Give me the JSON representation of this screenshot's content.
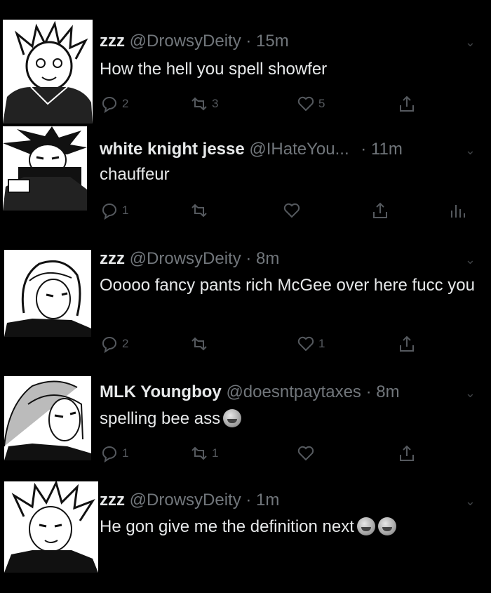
{
  "tweets": [
    {
      "name": "zzz",
      "handle": "@DrowsyDeity",
      "time": "· 15m",
      "text": "How the hell you spell showfer",
      "replies": "2",
      "retweets": "3",
      "likes": "5",
      "show_analytics": false
    },
    {
      "name": "white knight jesse",
      "handle": "@IHateYou...",
      "time": "· 11m",
      "text": "chauffeur",
      "replies": "1",
      "retweets": "",
      "likes": "",
      "show_analytics": true
    },
    {
      "name": "zzz",
      "handle": "@DrowsyDeity",
      "time": "· 8m",
      "text": "Ooooo fancy pants rich McGee over here fucc you",
      "replies": "2",
      "retweets": "",
      "likes": "1",
      "show_analytics": false
    },
    {
      "name": "MLK Youngboy",
      "handle": "@doesntpaytaxes",
      "time": "· 8m",
      "text": "spelling bee ass",
      "emoji_count": 1,
      "replies": "1",
      "retweets": "1",
      "likes": "",
      "show_analytics": false
    },
    {
      "name": "zzz",
      "handle": "@DrowsyDeity",
      "time": "· 1m",
      "text": "He gon give me the definition next",
      "emoji_count": 2,
      "replies": "",
      "retweets": "",
      "likes": "",
      "show_analytics": false
    }
  ],
  "icons": {
    "reply": "reply-icon",
    "retweet": "retweet-icon",
    "like": "heart-icon",
    "share": "share-icon",
    "analytics": "analytics-icon",
    "more": "chevron-down-icon",
    "emoji": "loudly-crying-face-emoji"
  },
  "colors": {
    "background": "#000000",
    "text": "#e7e9ea",
    "secondary": "#71767b",
    "icon": "#55595e"
  }
}
